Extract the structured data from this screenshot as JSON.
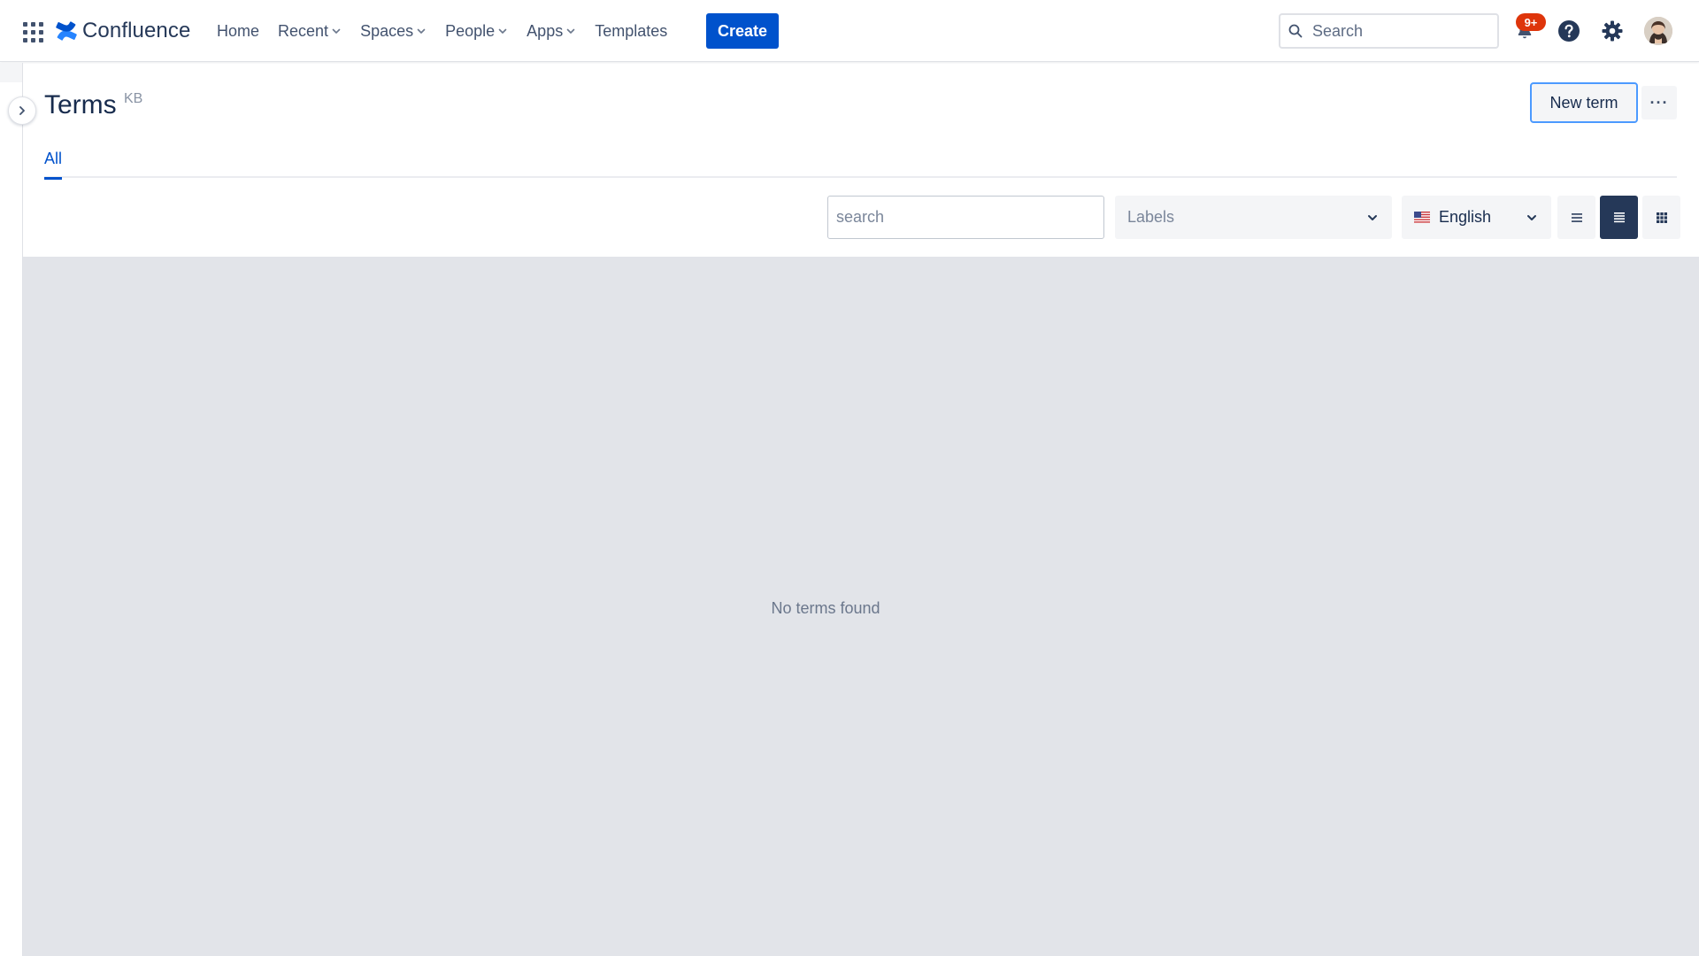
{
  "topnav": {
    "brand": "Confluence",
    "items": [
      {
        "label": "Home",
        "has_dropdown": false
      },
      {
        "label": "Recent",
        "has_dropdown": true
      },
      {
        "label": "Spaces",
        "has_dropdown": true
      },
      {
        "label": "People",
        "has_dropdown": true
      },
      {
        "label": "Apps",
        "has_dropdown": true
      },
      {
        "label": "Templates",
        "has_dropdown": false
      }
    ],
    "create_label": "Create",
    "search_placeholder": "Search",
    "notifications_badge": "9+",
    "icons": [
      "app-switcher-icon",
      "confluence-logo-icon",
      "search-icon",
      "notification-icon",
      "help-icon",
      "settings-icon",
      "avatar"
    ]
  },
  "page": {
    "title": "Terms",
    "space_key": "KB",
    "new_term_label": "New term",
    "more_label": "···",
    "tabs": [
      {
        "label": "All",
        "active": true
      }
    ]
  },
  "toolbar": {
    "search_placeholder": "search",
    "labels_placeholder": "Labels",
    "language": "English",
    "view_modes": [
      "compact",
      "list",
      "grid"
    ],
    "active_view": "list"
  },
  "content": {
    "empty_message": "No terms found"
  },
  "colors": {
    "primary": "#0052cc",
    "text": "#172b4d",
    "badge": "#de350b",
    "active_view_bg": "#253858",
    "content_bg": "#e2e4e9"
  }
}
